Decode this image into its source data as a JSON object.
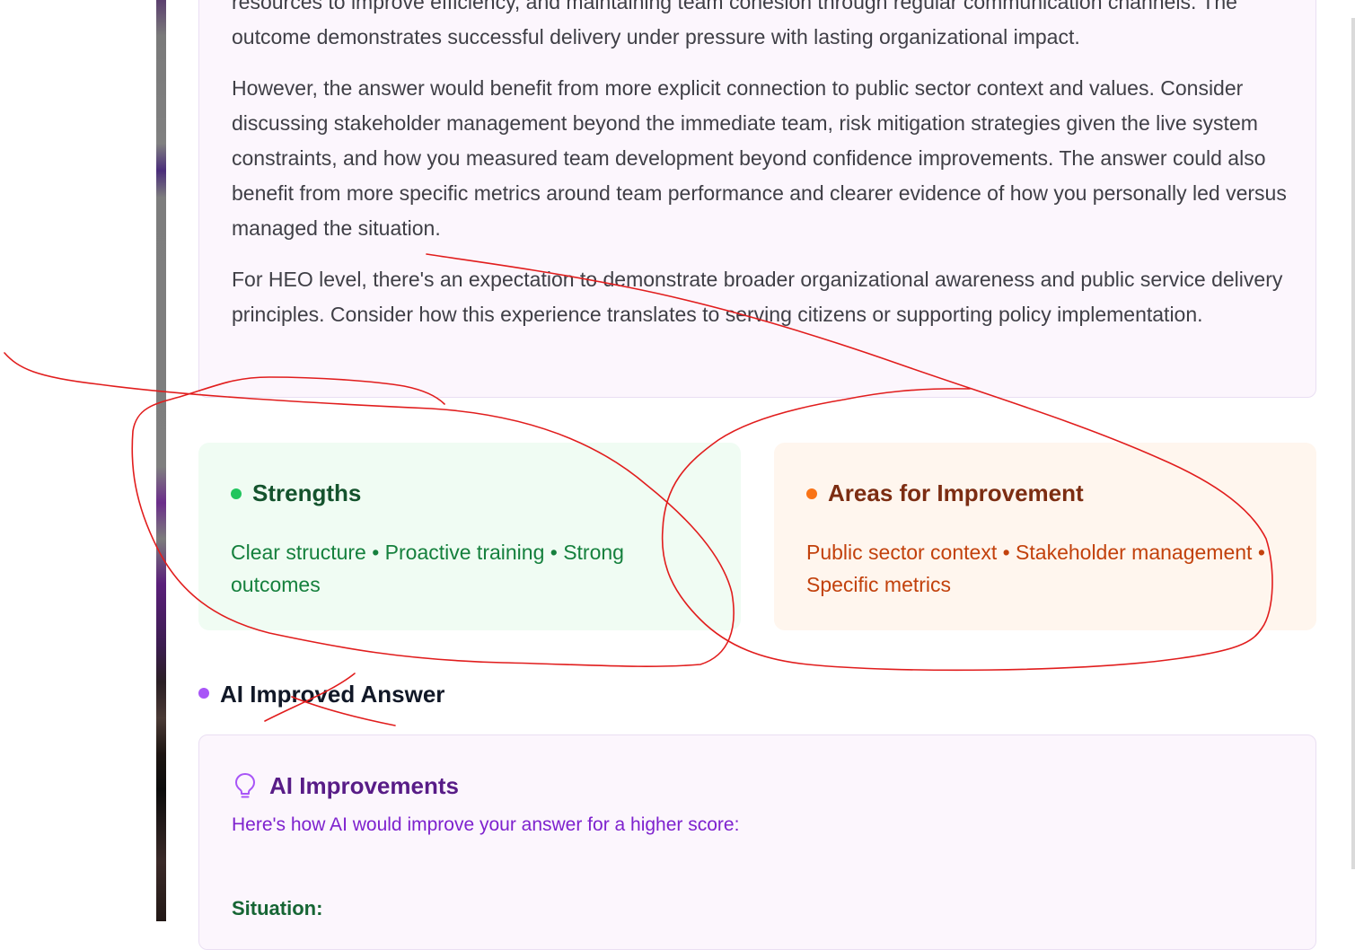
{
  "feedback": {
    "paragraphs": [
      "resources to improve efficiency, and maintaining team cohesion through regular communication channels. The outcome demonstrates successful delivery under pressure with lasting organizational impact.",
      "However, the answer would benefit from more explicit connection to public sector context and values. Consider discussing stakeholder management beyond the immediate team, risk mitigation strategies given the live system constraints, and how you measured team development beyond confidence improvements. The answer could also benefit from more specific metrics around team performance and clearer evidence of how you personally led versus managed the situation.",
      "For HEO level, there's an expectation to demonstrate broader organizational awareness and public service delivery principles. Consider how this experience translates to serving citizens or supporting policy implementation."
    ]
  },
  "strengths": {
    "title": "Strengths",
    "text": "Clear structure • Proactive training • Strong outcomes",
    "dot_color": "#22c55e"
  },
  "improvements": {
    "title": "Areas for Improvement",
    "text": "Public sector context • Stakeholder management • Specific metrics",
    "dot_color": "#f97316"
  },
  "ai_section": {
    "title": "AI Improved Answer",
    "dot_color": "#a855f7",
    "card_title": "AI Improvements",
    "card_icon": "lightbulb-icon",
    "card_subtitle": "Here's how AI would improve your answer for a higher score:",
    "situation_label": "Situation:"
  },
  "annotation_color": "#e11d1d"
}
